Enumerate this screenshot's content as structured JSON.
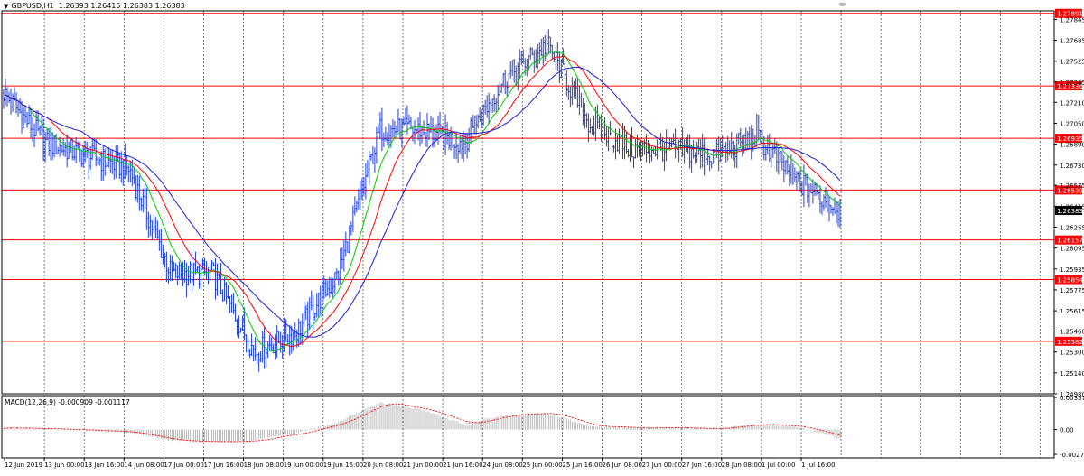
{
  "chart_info": {
    "symbol_label": "GBPUSD,H1",
    "ohlc": "1.26393 1.26415 1.26383 1.26383",
    "indicator_label": "MACD(12,26,9)",
    "indicator_values": "-0.000909 -0.001117"
  },
  "colors": {
    "candles": "#1f3fd6",
    "level_lines": "#ff0000",
    "ma_fast": "#00cc00",
    "ma_mid": "#ff0000",
    "ma_slow": "#1a1ad9",
    "macd_hist": "#b4b4b4",
    "macd_signal": "#ff0000",
    "grid": "#555555",
    "price_tag_bg": "#ff0000",
    "current_tag_bg": "#000000"
  },
  "price_axis": {
    "ticks": [
      "1.27845",
      "1.27685",
      "1.27525",
      "1.27365",
      "1.27210",
      "1.27050",
      "1.26890",
      "1.26730",
      "1.26575",
      "1.26415",
      "1.26255",
      "1.26095",
      "1.25935",
      "1.25775",
      "1.25615",
      "1.25460",
      "1.25300",
      "1.25140",
      "1.24980"
    ],
    "range": [
      1.2498,
      1.2791
    ]
  },
  "time_axis": {
    "labels": [
      "12 Jun 2019",
      "13 Jun 00:00",
      "13 Jun 16:00",
      "14 Jun 08:00",
      "17 Jun 00:00",
      "17 Jun 16:00",
      "18 Jun 08:00",
      "19 Jun 00:00",
      "19 Jun 16:00",
      "20 Jun 08:00",
      "21 Jun 00:00",
      "21 Jun 16:00",
      "24 Jun 08:00",
      "25 Jun 00:00",
      "25 Jun 16:00",
      "26 Jun 08:00",
      "27 Jun 00:00",
      "27 Jun 16:00",
      "28 Jun 08:00",
      "1 Jul 00:00",
      "1 Jul 16:00"
    ]
  },
  "horizontal_levels": [
    {
      "price": 1.27891,
      "label": "1.27891"
    },
    {
      "price": 1.27336,
      "label": "1.27336"
    },
    {
      "price": 1.26935,
      "label": "1.26935"
    },
    {
      "price": 1.26539,
      "label": "1.26539"
    },
    {
      "price": 1.26157,
      "label": "1.26157"
    },
    {
      "price": 1.25854,
      "label": "1.25854"
    },
    {
      "price": 1.25382,
      "label": "1.25382"
    }
  ],
  "current_price": {
    "price": 1.26383,
    "label": "1.26383"
  },
  "macd_axis": {
    "ticks": [
      "0.003576",
      "0.00",
      "-0.002764"
    ],
    "range": [
      -0.002764,
      0.003576
    ]
  },
  "chart_data": {
    "type": "line",
    "title": "GBPUSD,H1",
    "note": "Approximate closing prices (H1), read from the chart; plus moving averages and MACD sub-window",
    "x": [
      "12 Jun 2019",
      "13 Jun 00:00",
      "13 Jun 16:00",
      "14 Jun 08:00",
      "17 Jun 00:00",
      "17 Jun 16:00",
      "18 Jun 08:00",
      "19 Jun 00:00",
      "19 Jun 16:00",
      "20 Jun 08:00",
      "21 Jun 00:00",
      "21 Jun 16:00",
      "24 Jun 08:00",
      "25 Jun 00:00",
      "25 Jun 16:00",
      "26 Jun 08:00",
      "27 Jun 00:00",
      "27 Jun 16:00",
      "28 Jun 08:00",
      "1 Jul 00:00",
      "1 Jul 16:00"
    ],
    "series": [
      {
        "values": [
          1.2728,
          1.269,
          1.268,
          1.267,
          1.259,
          1.259,
          1.253,
          1.2545,
          1.259,
          1.27,
          1.27,
          1.269,
          1.274,
          1.2765,
          1.2705,
          1.2685,
          1.2685,
          1.268,
          1.2695,
          1.266,
          1.2638
        ]
      }
    ],
    "macd_values": [
      0.0002,
      0.0001,
      -0.0001,
      -0.0003,
      -0.0012,
      -0.0014,
      -0.0012,
      -0.0004,
      0.0008,
      0.003,
      0.0022,
      0.0006,
      0.0016,
      0.0018,
      0.0004,
      0.0002,
      0.0002,
      0.0001,
      0.0006,
      0.0003,
      -0.001
    ],
    "ylim": [
      1.2498,
      1.2791
    ]
  }
}
